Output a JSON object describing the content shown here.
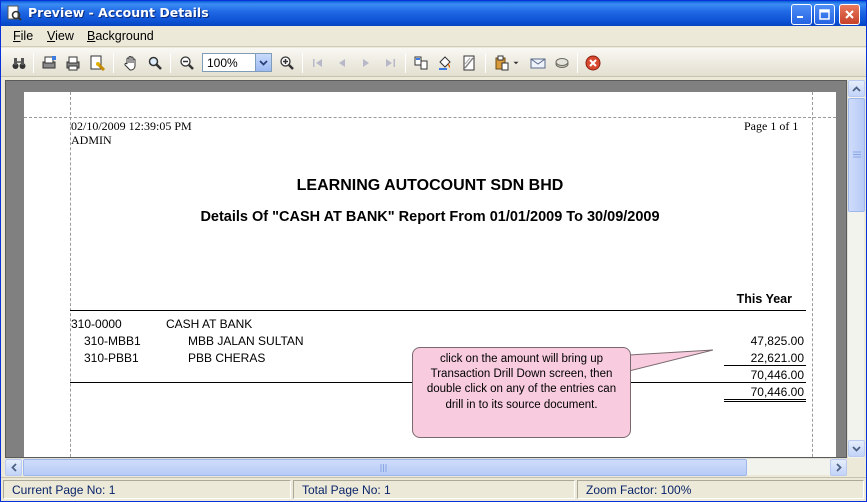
{
  "window": {
    "title": "Preview - Account Details",
    "accent": "#1e67e4"
  },
  "menu": [
    {
      "label": "File"
    },
    {
      "label": "View"
    },
    {
      "label": "Background"
    }
  ],
  "toolbar": {
    "zoom": "100%"
  },
  "report": {
    "printed_datetime": "02/10/2009 12:39:05 PM",
    "user": "ADMIN",
    "page_indicator": "Page 1 of 1",
    "company": "LEARNING AUTOCOUNT SDN BHD",
    "subtitle": "Details Of \"CASH AT BANK\" Report From 01/01/2009 To 30/09/2009",
    "column_header": "This Year",
    "group": {
      "code": "310-0000",
      "name": "CASH AT BANK"
    },
    "rows": [
      {
        "code": "310-MBB1",
        "name": "MBB JALAN SULTAN",
        "amount": "47,825.00"
      },
      {
        "code": "310-PBB1",
        "name": "PBB CHERAS",
        "amount": "22,621.00"
      }
    ],
    "subtotal": "70,446.00",
    "grand_total": "70,446.00"
  },
  "callout": {
    "text": "click on the amount will bring up Transaction Drill Down screen, then double click on any of the entries can drill in to its source document.",
    "color": "#f8ccde"
  },
  "status": {
    "current_page": "Current Page No: 1",
    "total_page": "Total Page No: 1",
    "zoom_factor": "Zoom Factor: 100%"
  }
}
